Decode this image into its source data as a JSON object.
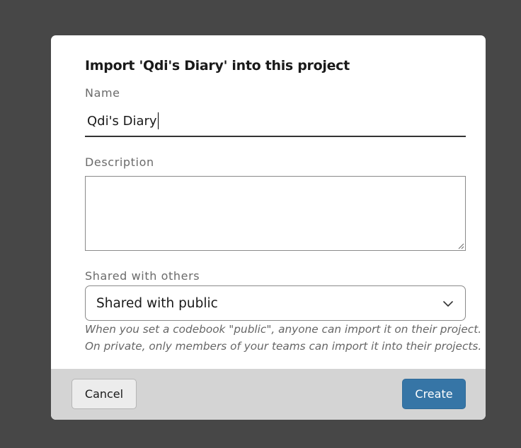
{
  "dialog": {
    "title": "Import 'Qdi's Diary' into this project"
  },
  "name_field": {
    "label": "Name",
    "value": "Qdi's Diary"
  },
  "description_field": {
    "label": "Description",
    "value": ""
  },
  "sharing_field": {
    "label": "Shared with others",
    "selected": "Shared with public",
    "help_line_1": "When you set a codebook \"public\", anyone can import it on their project.",
    "help_line_2": "On private, only members of your teams can import it into their projects."
  },
  "footer": {
    "cancel_label": "Cancel",
    "create_label": "Create"
  },
  "colors": {
    "overlay": "#474747",
    "primary_button": "#3675a6",
    "footer_bg": "#d4d4d4"
  },
  "icons": {
    "select_arrow": "chevron-down-icon",
    "textarea_resize": "resize-grip-icon"
  }
}
